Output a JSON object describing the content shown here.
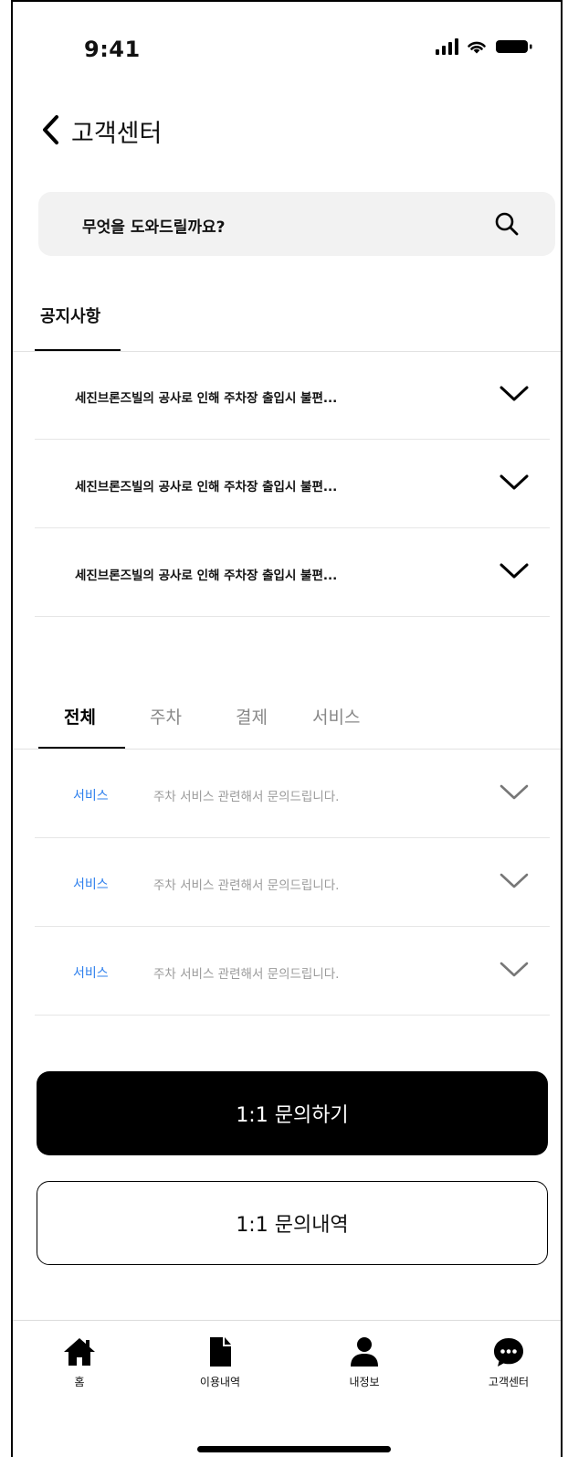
{
  "status_bar": {
    "time": "9:41"
  },
  "header": {
    "title": "고객센터"
  },
  "search": {
    "placeholder": "무엇을 도와드릴까요?"
  },
  "notices": {
    "tab_label": "공지사항",
    "items": [
      {
        "title": "세진브론즈빌의 공사로 인해 주차장 출입시 불편..."
      },
      {
        "title": "세진브론즈빌의 공사로 인해 주차장 출입시 불편..."
      },
      {
        "title": "세진브론즈빌의 공사로 인해 주차장 출입시 불편..."
      }
    ]
  },
  "faq": {
    "tabs": [
      {
        "label": "전체",
        "active": true
      },
      {
        "label": "주차",
        "active": false
      },
      {
        "label": "결제",
        "active": false
      },
      {
        "label": "서비스",
        "active": false
      }
    ],
    "items": [
      {
        "category": "서비스",
        "question": "주차 서비스 관련해서 문의드립니다."
      },
      {
        "category": "서비스",
        "question": "주차 서비스 관련해서 문의드립니다."
      },
      {
        "category": "서비스",
        "question": "주차 서비스 관련해서 문의드립니다."
      }
    ]
  },
  "actions": {
    "inquiry_label": "1:1 문의하기",
    "history_label": "1:1 문의내역"
  },
  "tab_bar": {
    "items": [
      {
        "label": "홈",
        "icon": "home-icon"
      },
      {
        "label": "이용내역",
        "icon": "document-icon"
      },
      {
        "label": "내정보",
        "icon": "person-icon"
      },
      {
        "label": "고객센터",
        "icon": "chat-bubble-icon"
      }
    ]
  },
  "colors": {
    "accent": "#2f80ed",
    "primary": "#000000",
    "muted_text": "#9a9a9a",
    "search_bg": "#f2f2f2"
  }
}
